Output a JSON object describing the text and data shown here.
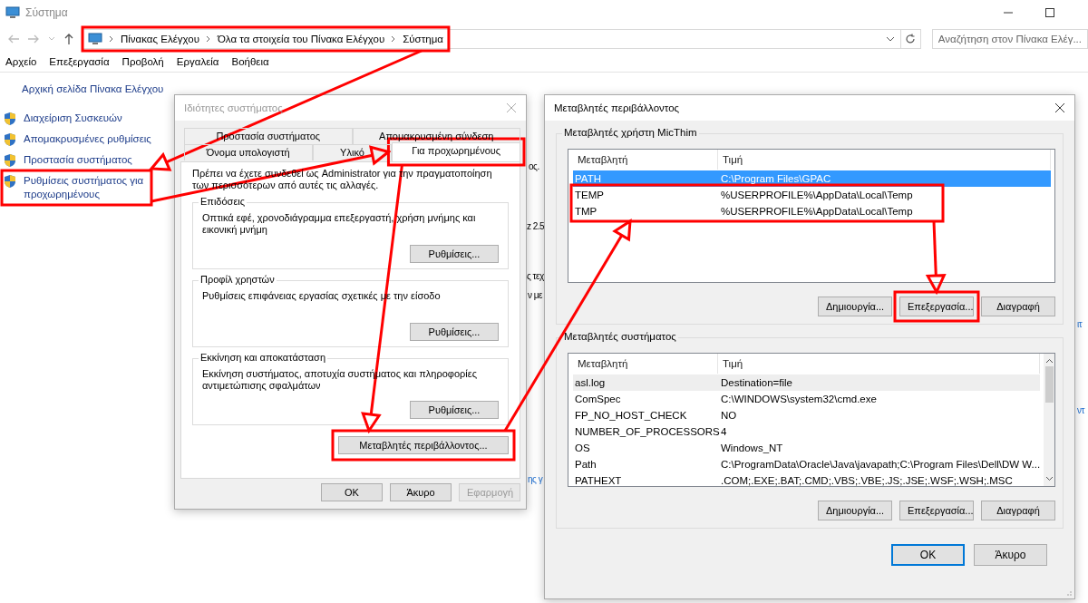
{
  "window": {
    "title": "Σύστημα"
  },
  "address_bar": {
    "breadcrumbs": [
      "Πίνακας Ελέγχου",
      "Όλα τα στοιχεία του Πίνακα Ελέγχου",
      "Σύστημα"
    ]
  },
  "search": {
    "placeholder": "Αναζήτηση στον Πίνακα Ελέγ..."
  },
  "menu": [
    "Αρχείο",
    "Επεξεργασία",
    "Προβολή",
    "Εργαλεία",
    "Βοήθεια"
  ],
  "sidebar": {
    "home": "Αρχική σελίδα Πίνακα Ελέγχου",
    "items": [
      "Διαχείριση Συσκευών",
      "Απομακρυσμένες ρυθμίσεις",
      "Προστασία συστήματος",
      "Ρυθμίσεις συστήματος για προχωρημένους"
    ]
  },
  "background_fragments": [
    {
      "text": "ος.",
      "kind": "text"
    },
    {
      "text": "z 2.5",
      "kind": "text"
    },
    {
      "text": "ς τεχ",
      "kind": "text"
    },
    {
      "text": "ν με",
      "kind": "text"
    },
    {
      "text": "ης γ",
      "kind": "link"
    },
    {
      "text": "ιτ",
      "kind": "link"
    },
    {
      "text": "ντ",
      "kind": "link"
    }
  ],
  "system_properties": {
    "title": "Ιδιότητες συστήματος",
    "active": false,
    "tab_rows": [
      [
        {
          "label": "Προστασία συστήματος",
          "selected": false
        },
        {
          "label": "Απομακρυσμένη σύνδεση",
          "selected": false
        }
      ],
      [
        {
          "label": "Όνομα υπολογιστή",
          "selected": false
        },
        {
          "label": "Υλικό",
          "selected": false
        },
        {
          "label": "Για προχωρημένους",
          "selected": true
        }
      ]
    ],
    "notice": "Πρέπει να έχετε συνδεθεί ως Administrator για την πραγματοποίηση των περισσότερων από αυτές τις αλλαγές.",
    "groups": [
      {
        "title": "Επιδόσεις",
        "description": "Οπτικά εφέ, χρονοδιάγραμμα επεξεργαστή, χρήση μνήμης και εικονική μνήμη",
        "button": "Ρυθμίσεις..."
      },
      {
        "title": "Προφίλ χρηστών",
        "description": "Ρυθμίσεις επιφάνειας εργασίας σχετικές με την είσοδο",
        "button": "Ρυθμίσεις..."
      },
      {
        "title": "Εκκίνηση και αποκατάσταση",
        "description": "Εκκίνηση συστήματος, αποτυχία συστήματος και πληροφορίες αντιμετώπισης σφαλμάτων",
        "button": "Ρυθμίσεις..."
      }
    ],
    "env_button": "Μεταβλητές περιβάλλοντος...",
    "buttons": [
      {
        "label": "OK",
        "disabled": false
      },
      {
        "label": "Άκυρο",
        "disabled": false
      },
      {
        "label": "Εφαρμογή",
        "disabled": true
      }
    ]
  },
  "environment_variables": {
    "title": "Μεταβλητές περιβάλλοντος",
    "user_vars": {
      "title": "Μεταβλητές χρήστη MicThim",
      "columns": [
        "Μεταβλητή",
        "Τιμή"
      ],
      "rows": [
        {
          "name": "PATH",
          "value": "C:\\Program Files\\GPAC",
          "selected": true
        },
        {
          "name": "TEMP",
          "value": "%USERPROFILE%\\AppData\\Local\\Temp",
          "selected": false
        },
        {
          "name": "TMP",
          "value": "%USERPROFILE%\\AppData\\Local\\Temp",
          "selected": false
        }
      ],
      "buttons": [
        "Δημιουργία...",
        "Επεξεργασία...",
        "Διαγραφή"
      ]
    },
    "system_vars": {
      "title": "Μεταβλητές συστήματος",
      "columns": [
        "Μεταβλητή",
        "Τιμή"
      ],
      "rows": [
        {
          "name": "asl.log",
          "value": "Destination=file",
          "selected": false,
          "hovered": true
        },
        {
          "name": "ComSpec",
          "value": "C:\\WINDOWS\\system32\\cmd.exe",
          "selected": false,
          "hovered": false
        },
        {
          "name": "FP_NO_HOST_CHECK",
          "value": "NO",
          "selected": false,
          "hovered": false
        },
        {
          "name": "NUMBER_OF_PROCESSORS",
          "value": "4",
          "selected": false,
          "hovered": false
        },
        {
          "name": "OS",
          "value": "Windows_NT",
          "selected": false,
          "hovered": false
        },
        {
          "name": "Path",
          "value": "C:\\ProgramData\\Oracle\\Java\\javapath;C:\\Program Files\\Dell\\DW W...",
          "selected": false,
          "hovered": false
        },
        {
          "name": "PATHEXT",
          "value": ".COM;.EXE;.BAT;.CMD;.VBS;.VBE;.JS;.JSE;.WSF;.WSH;.MSC",
          "selected": false,
          "hovered": false
        }
      ],
      "buttons": [
        "Δημιουργία...",
        "Επεξεργασία...",
        "Διαγραφή"
      ]
    },
    "buttons": [
      {
        "label": "OK",
        "default": true
      },
      {
        "label": "Άκυρο",
        "default": false
      }
    ]
  }
}
